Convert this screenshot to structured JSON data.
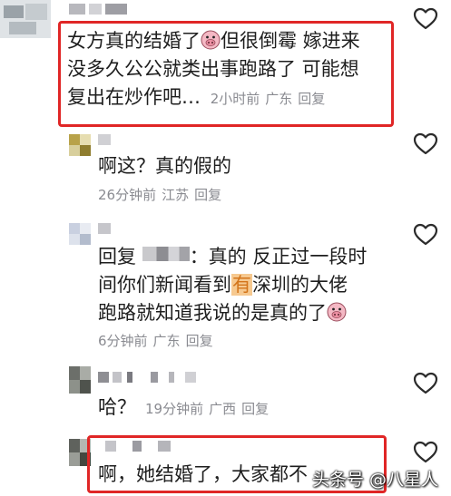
{
  "comments": [
    {
      "line1_before": "女方真的结婚了",
      "line1_after": "但很倒霉 嫁进来",
      "line2": "没多久公公就类出事跑路了 可能想",
      "line3": "复出在炒作吧…",
      "time": "2小时前",
      "location": "广东",
      "reply": "回复"
    },
    {
      "text": "啊这？真的假的",
      "time": "26分钟前",
      "location": "江苏",
      "reply": "回复"
    },
    {
      "line1_prefix": "回复",
      "line1_after": "：真的 反正过一段时",
      "line2_before": "间你们新闻看到",
      "line2_highlight": "有",
      "line2_after": "深圳的大佬",
      "line3": "跑路就知道我说的是真的了",
      "time": "6分钟前",
      "location": "广东",
      "reply": "回复"
    },
    {
      "text": "哈？",
      "time": "19分钟前",
      "location": "广西",
      "reply": "回复"
    },
    {
      "text": "啊，她结婚了，大家都不"
    }
  ],
  "watermark": "头条号 @八星人",
  "colors": {
    "highlight_box": "#e02626",
    "meta_text": "#8a8b91",
    "highlight_bg": "#f6c990"
  },
  "icons": {
    "like": "heart-outline-icon",
    "emoji": "pig-face-emoji-icon"
  }
}
